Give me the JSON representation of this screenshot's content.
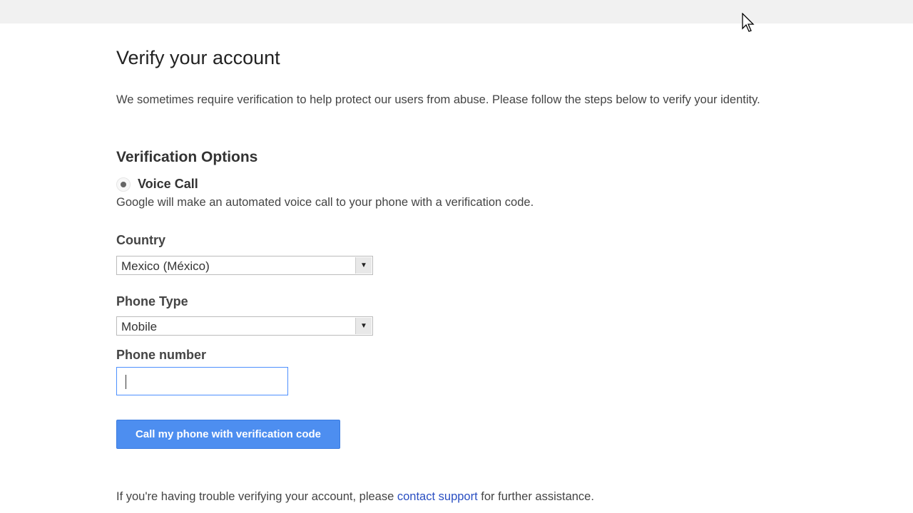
{
  "page": {
    "title": "Verify your account",
    "intro": "We sometimes require verification to help protect our users from abuse. Please follow the steps below to verify your identity.",
    "section_title": "Verification Options",
    "option": {
      "label": "Voice Call",
      "selected": true,
      "description": "Google will make an automated voice call to your phone with a verification code."
    },
    "country": {
      "label": "Country",
      "value": "Mexico (México)"
    },
    "phone_type": {
      "label": "Phone Type",
      "value": "Mobile"
    },
    "phone_number": {
      "label": "Phone number",
      "value": ""
    },
    "submit_label": "Call my phone with verification code",
    "footer": {
      "before": "If you're having trouble verifying your account, please ",
      "link": "contact support",
      "after": " for further assistance."
    }
  }
}
